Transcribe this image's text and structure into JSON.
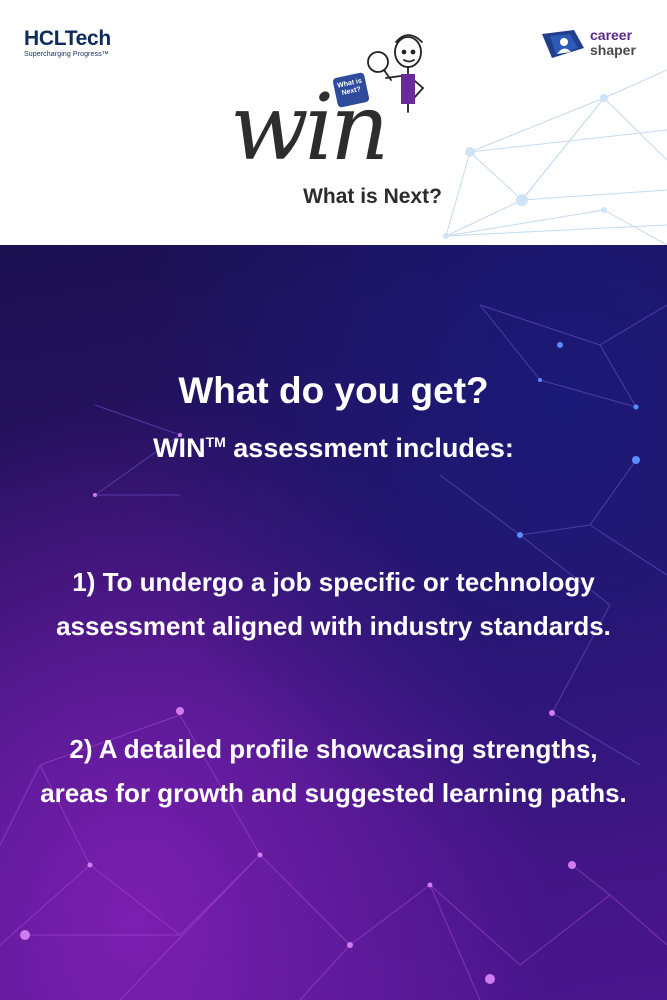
{
  "header": {
    "hcl_logo": {
      "name": "HCLTech",
      "tagline": "Supercharging Progress™"
    },
    "career_shaper_logo": {
      "line1": "career",
      "line2": "shaper",
      "icon": "career-shaper-icon"
    },
    "win_logo": {
      "title": "win",
      "badge": "What is Next?",
      "subtitle": "What is Next?"
    }
  },
  "content": {
    "heading": "What do you get?",
    "subheading_prefix": "WIN",
    "subheading_tm": "TM",
    "subheading_suffix": " assessment includes:",
    "points": [
      {
        "text": "1) To undergo a job specific or technology assessment aligned with industry standards."
      },
      {
        "text": "2) A detailed profile showcasing strengths, areas for growth and suggested learning paths."
      }
    ]
  },
  "colors": {
    "header_bg": "#ffffff",
    "hcl_blue": "#0f2a5c",
    "career_purple": "#5a2a8a",
    "body_dark": "#1a1050",
    "body_purple": "#4a168d",
    "text_white": "#ffffff"
  }
}
